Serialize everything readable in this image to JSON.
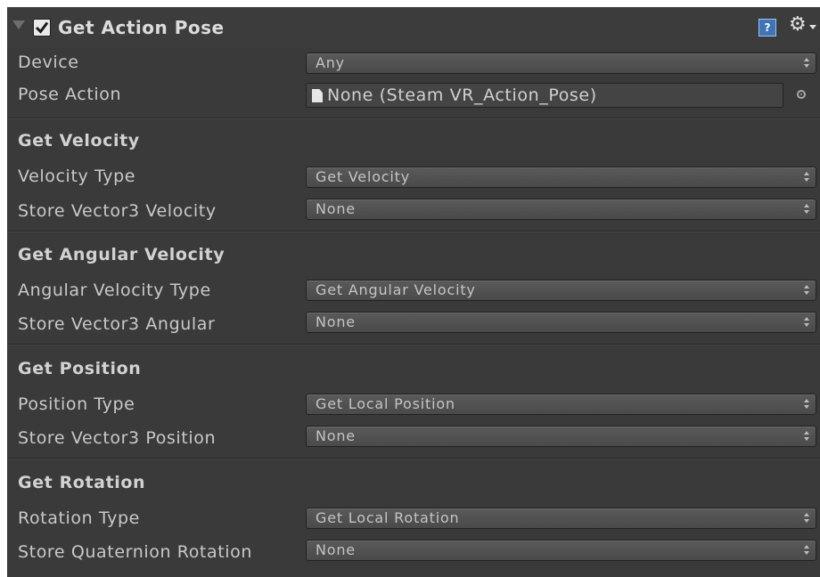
{
  "header": {
    "title": "Get Action Pose",
    "enabled": true,
    "help_glyph": "?",
    "icons": [
      "foldout-arrow-icon",
      "checkmark-icon",
      "help-icon",
      "gear-icon"
    ]
  },
  "fields": {
    "device": {
      "label": "Device",
      "value": "Any"
    },
    "pose_action": {
      "label": "Pose Action",
      "value": "None (Steam VR_Action_Pose)"
    }
  },
  "sections": [
    {
      "title": "Get Velocity",
      "rows": [
        {
          "label": "Velocity Type",
          "value": "Get Velocity"
        },
        {
          "label": "Store Vector3 Velocity",
          "value": "None"
        }
      ]
    },
    {
      "title": "Get Angular Velocity",
      "rows": [
        {
          "label": "Angular Velocity Type",
          "value": "Get Angular Velocity"
        },
        {
          "label": "Store Vector3 Angular",
          "value": "None"
        }
      ]
    },
    {
      "title": "Get Position",
      "rows": [
        {
          "label": "Position Type",
          "value": "Get Local Position"
        },
        {
          "label": "Store Vector3 Position",
          "value": "None"
        }
      ]
    },
    {
      "title": "Get Rotation",
      "rows": [
        {
          "label": "Rotation Type",
          "value": "Get Local Rotation"
        },
        {
          "label": "Store Quaternion Rotation",
          "value": "None"
        }
      ]
    }
  ],
  "colors": {
    "panel_bg": "#3a3a3a",
    "text": "#c9c9c9",
    "dropdown_bg": "#525252",
    "help_blue": "#3f74b8"
  }
}
